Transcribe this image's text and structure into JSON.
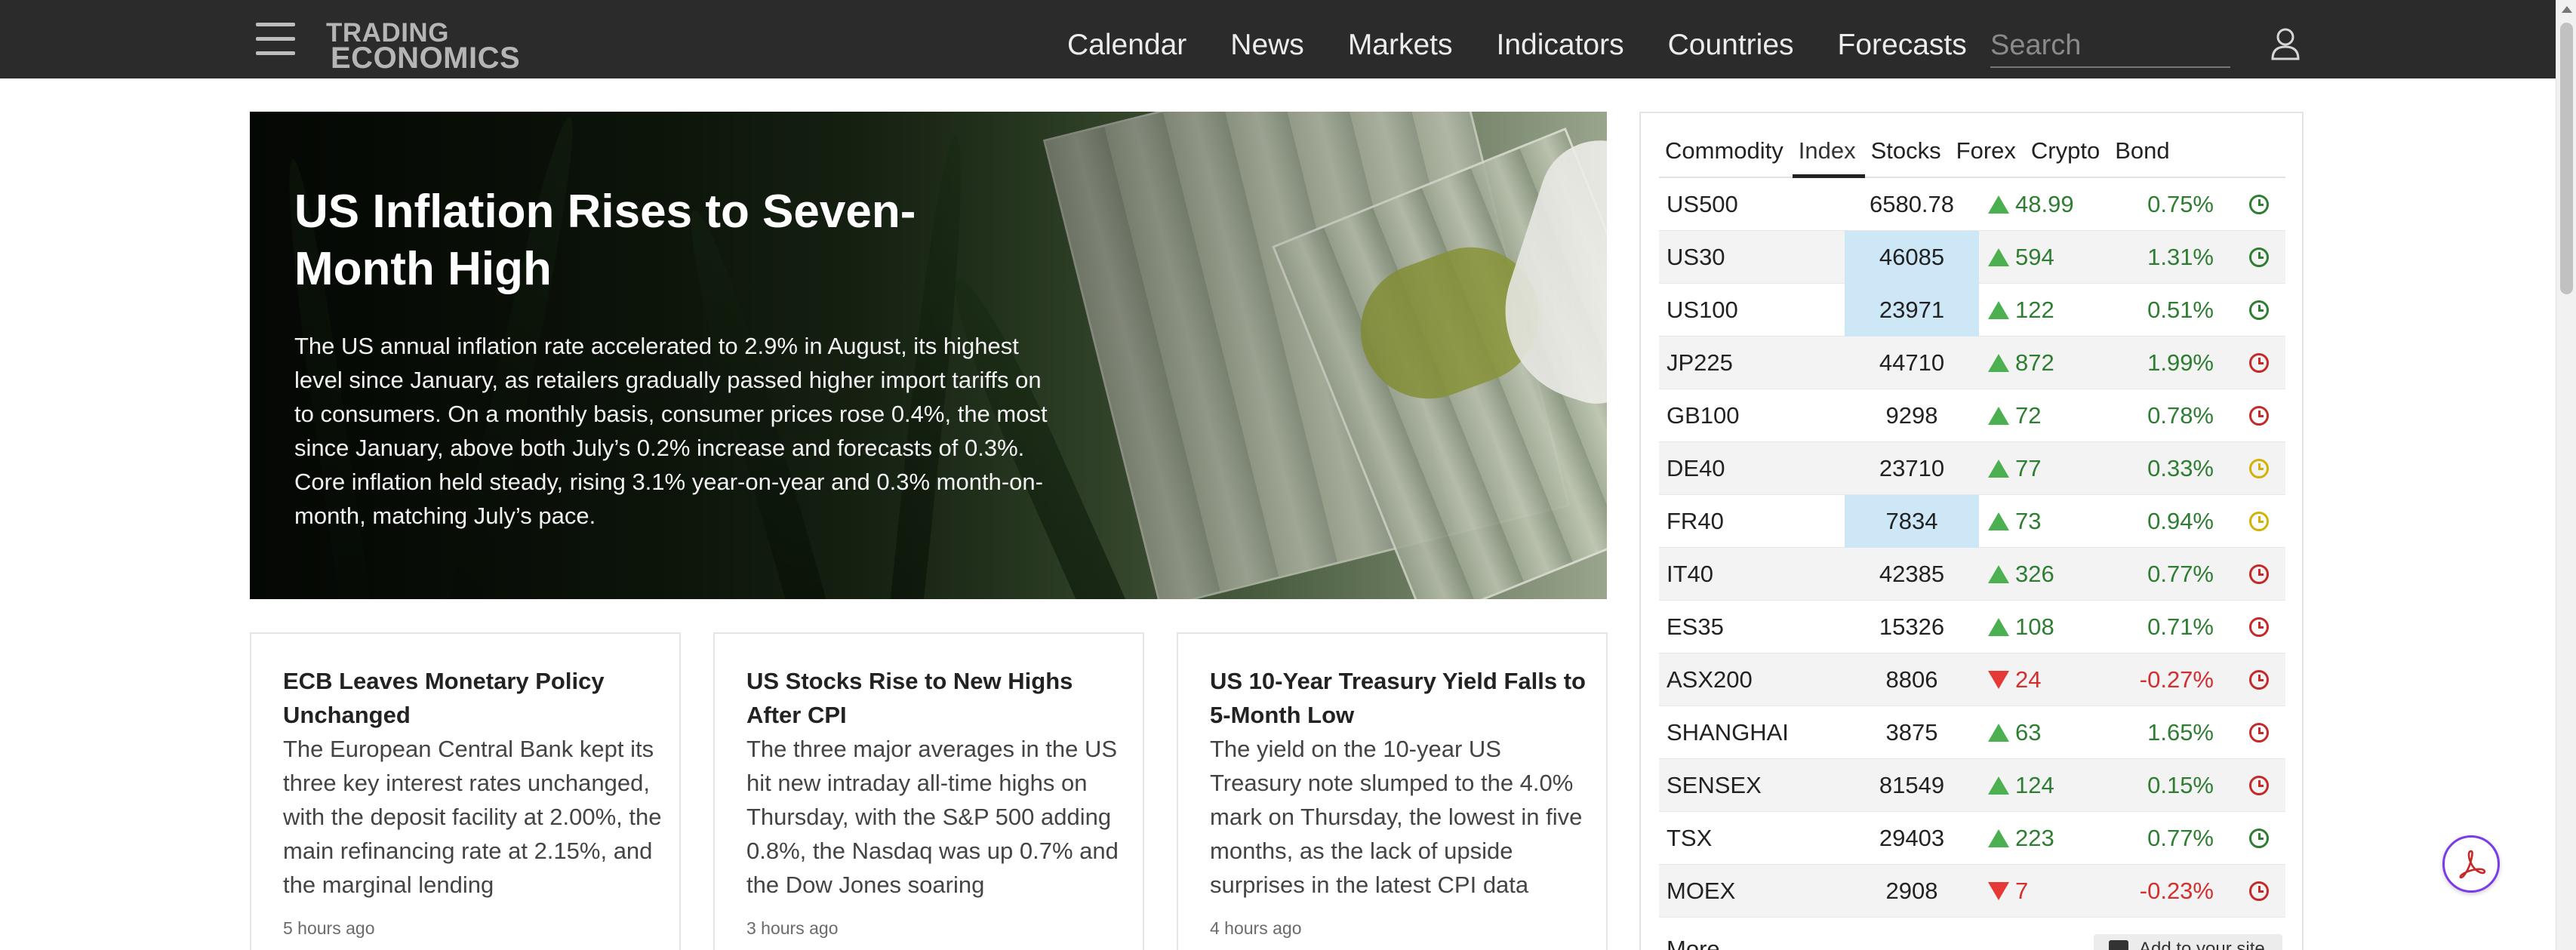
{
  "header": {
    "logo_line1": "TRADING",
    "logo_line2": "ECONOMICS",
    "nav": [
      "Calendar",
      "News",
      "Markets",
      "Indicators",
      "Countries",
      "Forecasts"
    ],
    "search_placeholder": "Search"
  },
  "hero": {
    "title": "US Inflation Rises to Seven-Month High",
    "text": "The US annual inflation rate accelerated to 2.9% in August, its highest level since January, as retailers gradually passed higher import tariffs on to consumers. On a monthly basis, consumer prices rose 0.4%, the most since January, above both July’s 0.2% increase and forecasts of 0.3%. Core inflation held steady, rising 3.1% year-on-year and 0.3% month-on-month, matching July’s pace."
  },
  "cards": [
    {
      "title": "ECB Leaves Monetary Policy Unchanged",
      "body": "The European Central Bank kept its three key interest rates unchanged, with the deposit facility at 2.00%, the main refinancing rate at 2.15%, and the marginal lending",
      "time": "5 hours ago"
    },
    {
      "title": "US Stocks Rise to New Highs After CPI",
      "body": "The three major averages in the US hit new intraday all-time highs on Thursday, with the S&P 500 adding 0.8%, the Nasdaq was up 0.7% and the Dow Jones soaring",
      "time": "3 hours ago"
    },
    {
      "title": "US 10-Year Treasury Yield Falls to 5-Month Low",
      "body": "The yield on the 10-year US Treasury note slumped to the 4.0% mark on Thursday, the lowest in five months, as the lack of upside surprises in the latest CPI data",
      "time": "4 hours ago"
    }
  ],
  "markets": {
    "tabs": [
      "Commodity",
      "Index",
      "Stocks",
      "Forex",
      "Crypto",
      "Bond"
    ],
    "active_tab": "Index",
    "rows": [
      {
        "symbol": "US500",
        "price": "6580.78",
        "dir": "up",
        "change": "48.99",
        "pct": "0.75%",
        "highlight": false,
        "status": "green"
      },
      {
        "symbol": "US30",
        "price": "46085",
        "dir": "up",
        "change": "594",
        "pct": "1.31%",
        "highlight": true,
        "status": "green"
      },
      {
        "symbol": "US100",
        "price": "23971",
        "dir": "up",
        "change": "122",
        "pct": "0.51%",
        "highlight": true,
        "status": "green"
      },
      {
        "symbol": "JP225",
        "price": "44710",
        "dir": "up",
        "change": "872",
        "pct": "1.99%",
        "highlight": false,
        "status": "red"
      },
      {
        "symbol": "GB100",
        "price": "9298",
        "dir": "up",
        "change": "72",
        "pct": "0.78%",
        "highlight": false,
        "status": "red"
      },
      {
        "symbol": "DE40",
        "price": "23710",
        "dir": "up",
        "change": "77",
        "pct": "0.33%",
        "highlight": false,
        "status": "yellow"
      },
      {
        "symbol": "FR40",
        "price": "7834",
        "dir": "up",
        "change": "73",
        "pct": "0.94%",
        "highlight": true,
        "status": "yellow"
      },
      {
        "symbol": "IT40",
        "price": "42385",
        "dir": "up",
        "change": "326",
        "pct": "0.77%",
        "highlight": false,
        "status": "red"
      },
      {
        "symbol": "ES35",
        "price": "15326",
        "dir": "up",
        "change": "108",
        "pct": "0.71%",
        "highlight": false,
        "status": "red"
      },
      {
        "symbol": "ASX200",
        "price": "8806",
        "dir": "down",
        "change": "24",
        "pct": "-0.27%",
        "highlight": false,
        "status": "red"
      },
      {
        "symbol": "SHANGHAI",
        "price": "3875",
        "dir": "up",
        "change": "63",
        "pct": "1.65%",
        "highlight": false,
        "status": "red"
      },
      {
        "symbol": "SENSEX",
        "price": "81549",
        "dir": "up",
        "change": "124",
        "pct": "0.15%",
        "highlight": false,
        "status": "red"
      },
      {
        "symbol": "TSX",
        "price": "29403",
        "dir": "up",
        "change": "223",
        "pct": "0.77%",
        "highlight": false,
        "status": "green"
      },
      {
        "symbol": "MOEX",
        "price": "2908",
        "dir": "down",
        "change": "7",
        "pct": "-0.23%",
        "highlight": false,
        "status": "red"
      }
    ],
    "more_label": "More",
    "add_label": "Add to your site"
  },
  "colors": {
    "topbar": "#2b2b2b",
    "up": "#2e7d32",
    "down": "#d32f2f",
    "status_green": "#2e7d32",
    "status_red": "#c62828",
    "status_yellow": "#d4b106",
    "price_highlight": "#cde7f6"
  },
  "icons": [
    "hamburger-menu-icon",
    "user-icon",
    "clock-icon",
    "pdf-icon"
  ]
}
